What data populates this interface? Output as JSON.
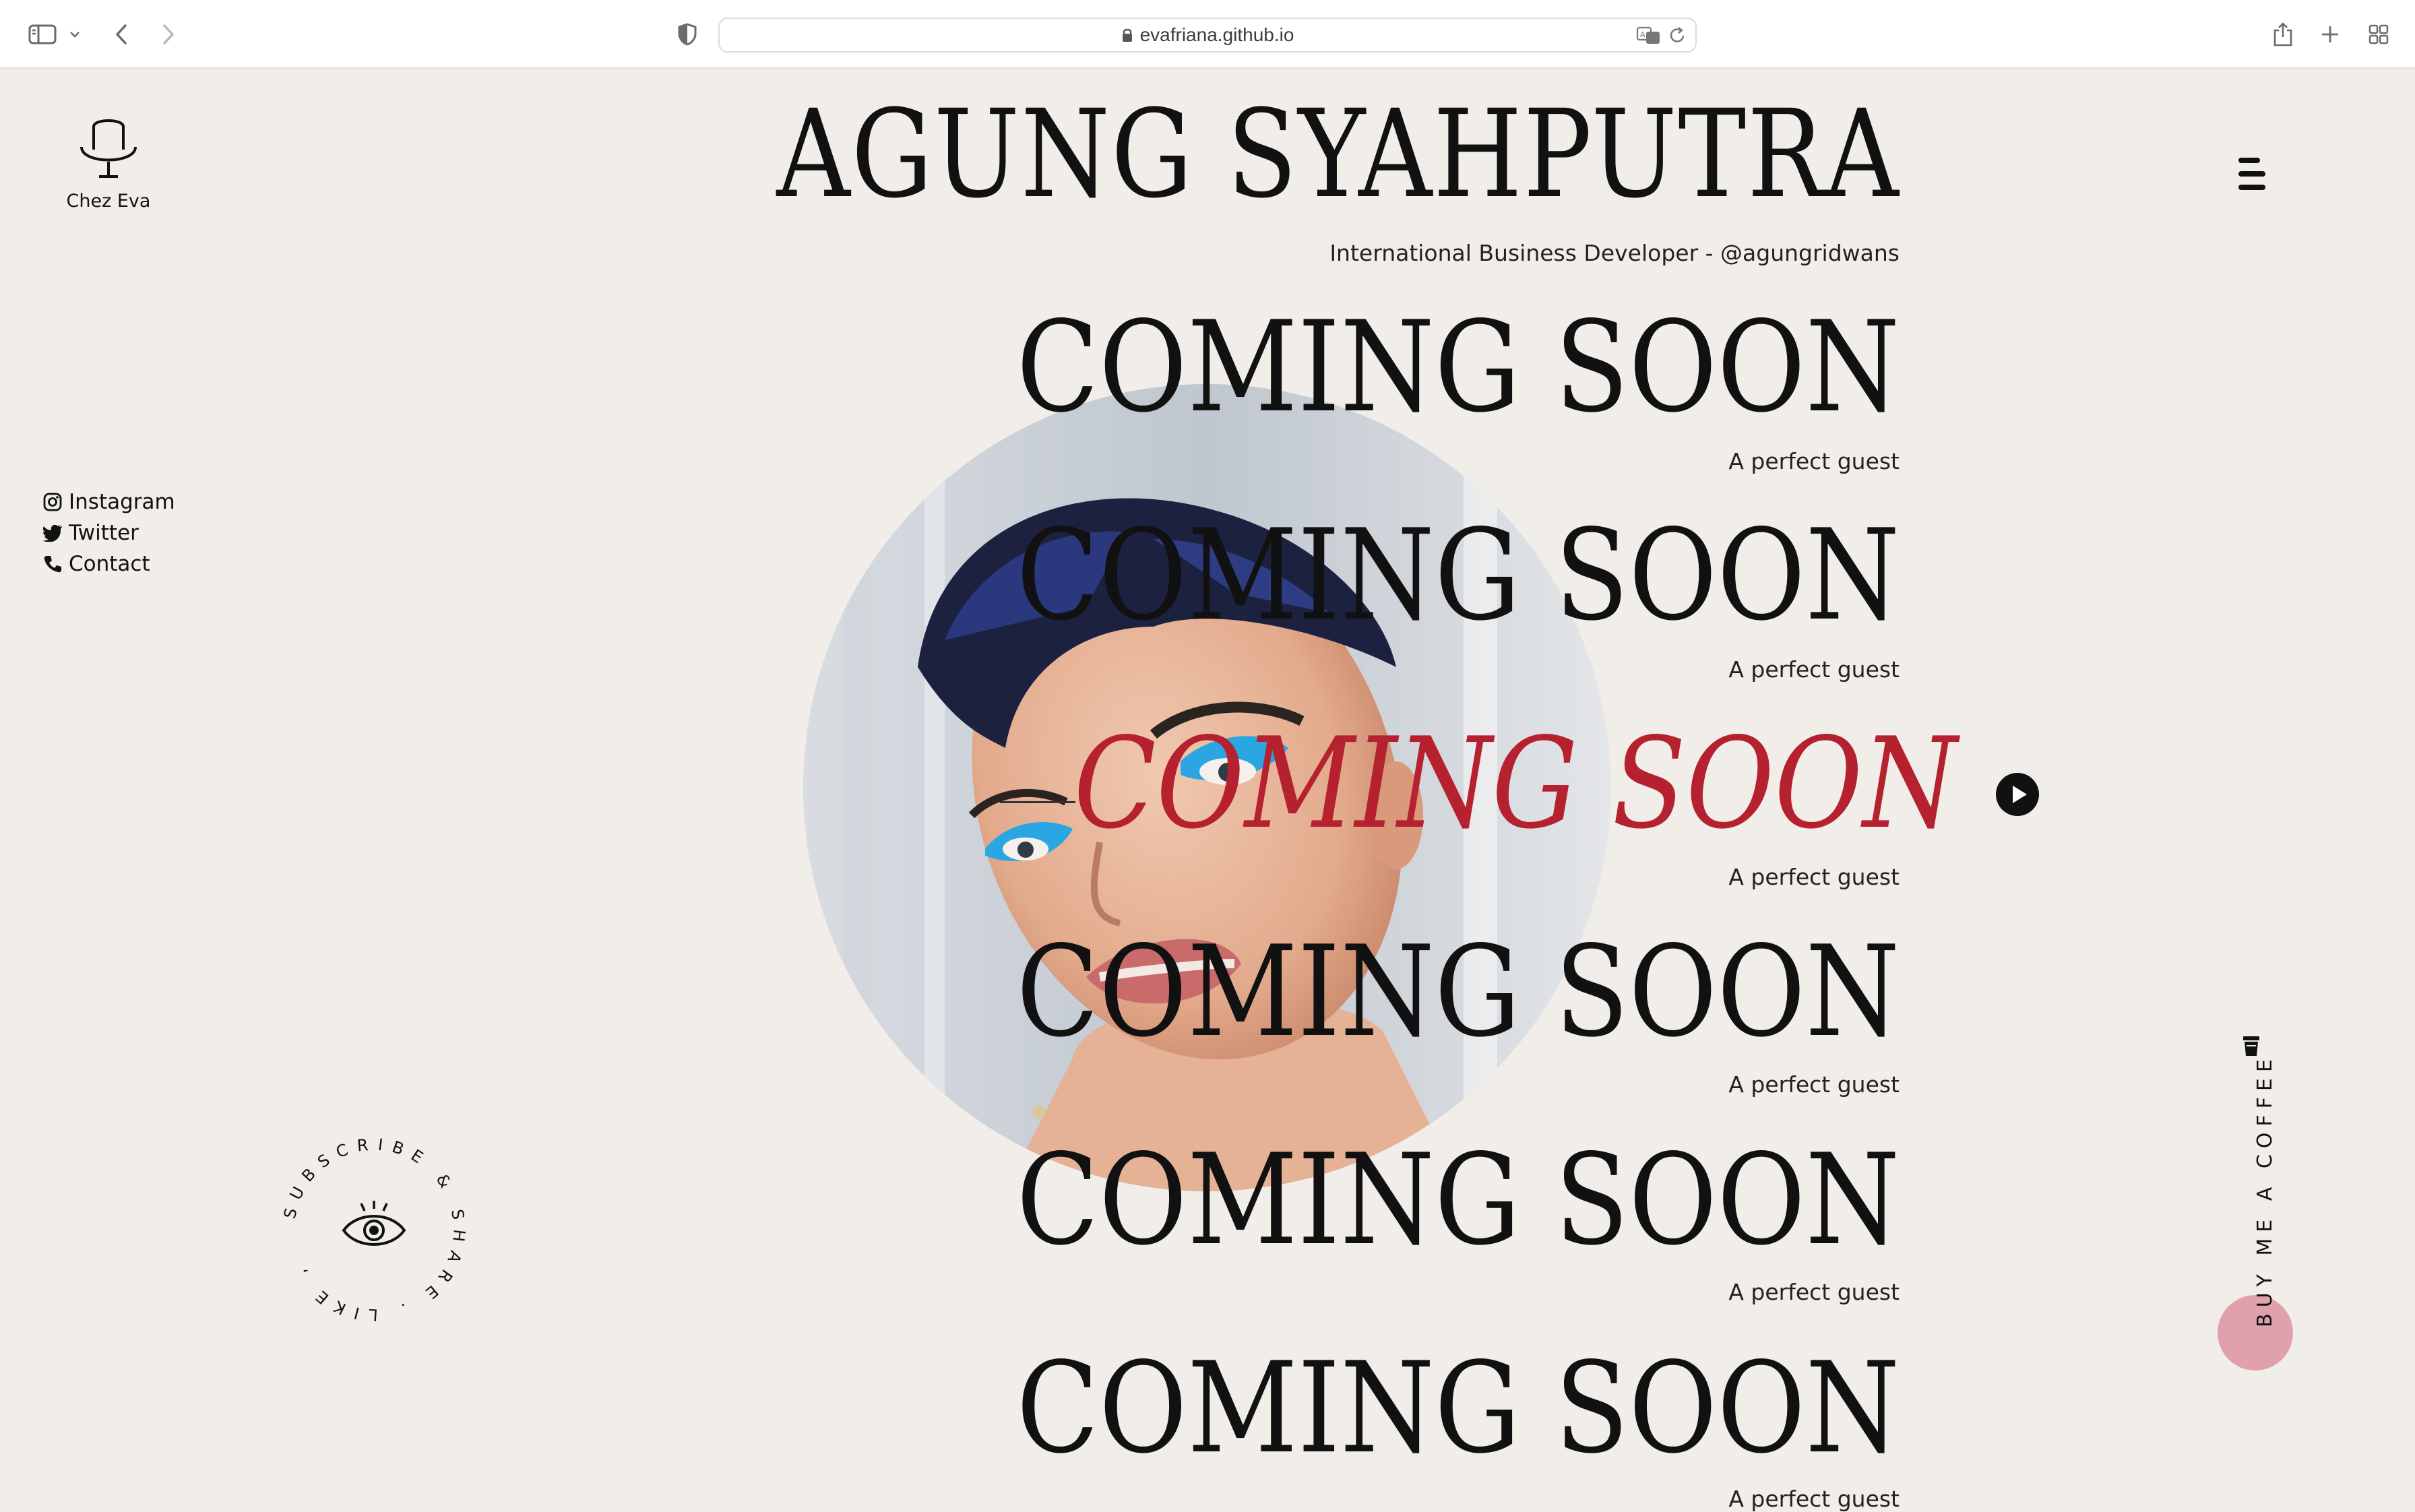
{
  "browser": {
    "url": "evafriana.github.io"
  },
  "site": {
    "logo_label": "Chez Eva",
    "title": "AGUNG SYAHPUTRA",
    "subtitle": "International Business Developer - @agungridwans"
  },
  "social": [
    {
      "label": "Instagram",
      "icon": "instagram-icon"
    },
    {
      "label": "Twitter",
      "icon": "twitter-icon"
    },
    {
      "label": "Contact",
      "icon": "phone-icon"
    }
  ],
  "episodes": [
    {
      "title": "COMING SOON",
      "subtitle": "A perfect guest",
      "active": false
    },
    {
      "title": "COMING SOON",
      "subtitle": "A perfect guest",
      "active": false
    },
    {
      "title": "COMING SOON",
      "subtitle": "A perfect guest",
      "active": true
    },
    {
      "title": "COMING SOON",
      "subtitle": "A perfect guest",
      "active": false
    },
    {
      "title": "COMING SOON",
      "subtitle": "A perfect guest",
      "active": false
    },
    {
      "title": "COMING SOON",
      "subtitle": "A perfect guest",
      "active": false
    }
  ],
  "badge": {
    "circular_text": "SUBSCRIBE & SHARE . LIKE ,"
  },
  "coffee": {
    "label": "BUY ME A COFFEE"
  },
  "colors": {
    "background": "#f1eee9",
    "accent_red": "#b5212f",
    "coffee_pink": "#e0a1ad",
    "text": "#111111"
  }
}
